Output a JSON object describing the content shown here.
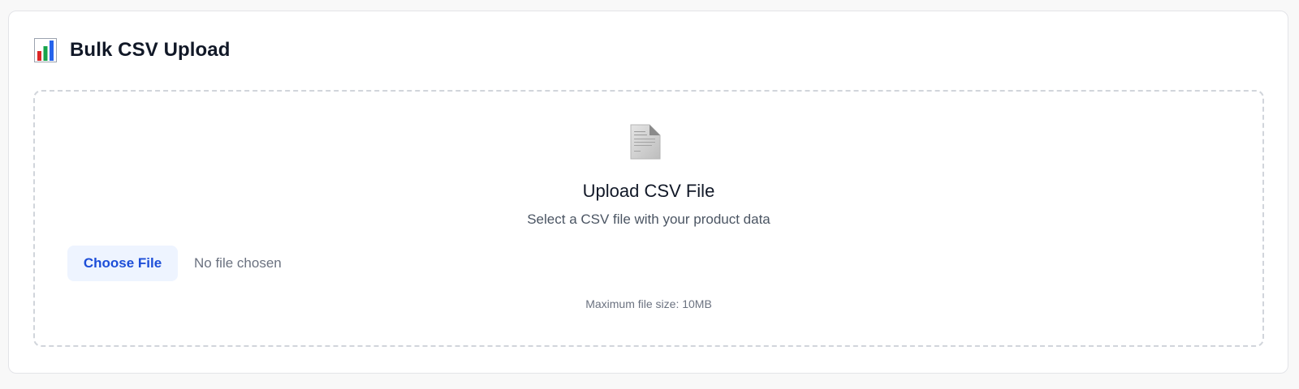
{
  "header": {
    "icon": "bar-chart-icon",
    "title": "Bulk CSV Upload"
  },
  "dropzone": {
    "icon": "document-icon",
    "heading": "Upload CSV File",
    "subtitle": "Select a CSV file with your product data",
    "choose_label": "Choose File",
    "file_status": "No file chosen",
    "max_size_note": "Maximum file size: 10MB"
  },
  "colors": {
    "button_bg": "#eef4ff",
    "button_text": "#1d4ed8",
    "border_dashed": "#d1d5db",
    "chart_red": "#dc2626",
    "chart_green": "#16a34a",
    "chart_blue": "#2563eb"
  }
}
